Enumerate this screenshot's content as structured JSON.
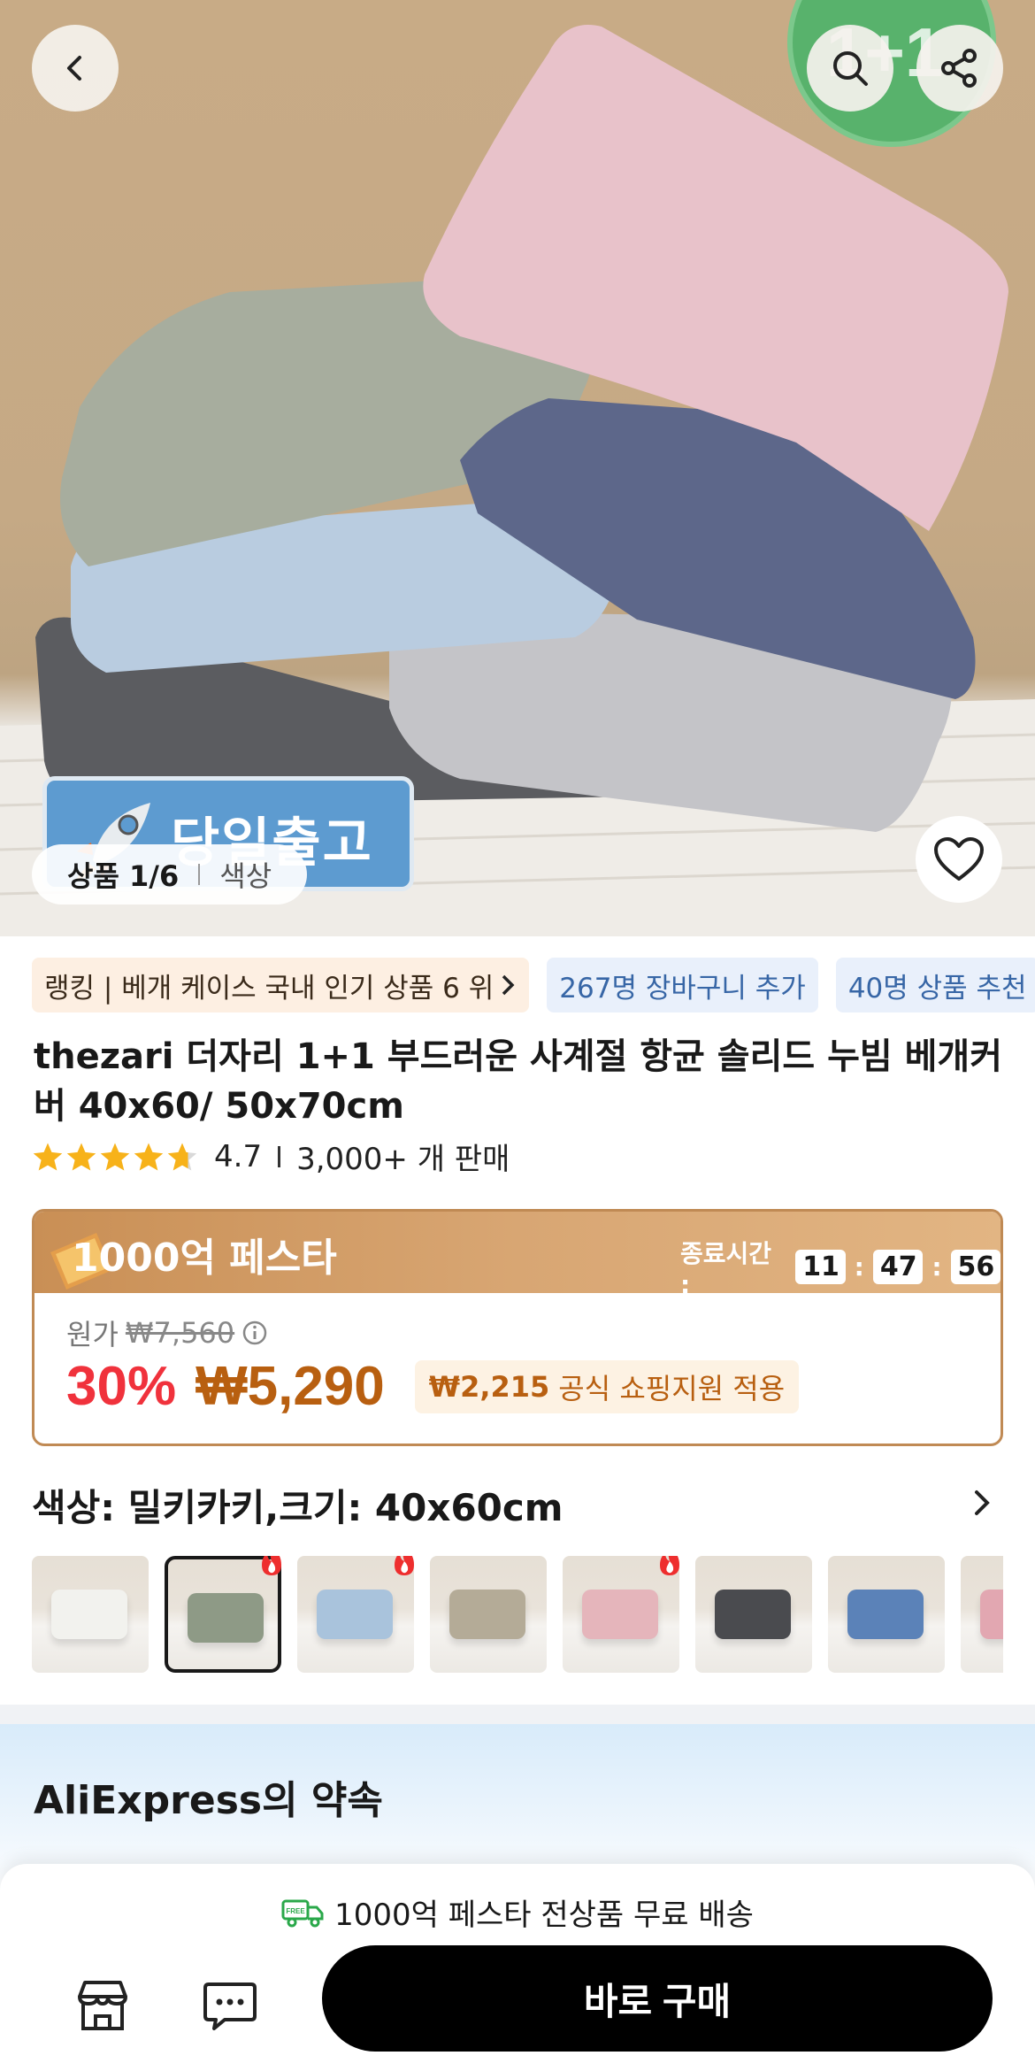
{
  "hero": {
    "promo_badge": "1+1",
    "shipping_badge": "당일출고",
    "pager": {
      "count": "상품 1/6",
      "tab": "색상"
    }
  },
  "tags": {
    "ranking": "랭킹 | 베개 케이스 국내 인기 상품 6 위",
    "cart": "267명 장바구니 추가",
    "recommend": "40명 상품 추천"
  },
  "product": {
    "brand": "thezari",
    "title_rest": "더자리 1+1 부드러운 사계절 항균 솔리드 누빔 베개커버 40x60/ 50x70cm",
    "rating": 4.7,
    "rating_text": "4.7",
    "sold": "3,000+ 개 판매"
  },
  "price_card": {
    "event_name": "1000억 페스타",
    "end_label": "종료시간 :",
    "timer": {
      "h": "11",
      "m": "47",
      "s": "56"
    },
    "original_label": "원가",
    "original_price": "₩7,560",
    "discount": "30%",
    "price": "₩5,290",
    "support_amount": "₩2,215",
    "support_text": "공식 쇼핑지원 적용"
  },
  "options": {
    "label": "색상: 밀키카키,크기: 40x60cm",
    "thumbs": [
      {
        "color": "#f2f2ee",
        "hot": false,
        "selected": false
      },
      {
        "color": "#8e9a86",
        "hot": true,
        "selected": true
      },
      {
        "color": "#a9c3dc",
        "hot": true,
        "selected": false
      },
      {
        "color": "#b4ab97",
        "hot": false,
        "selected": false
      },
      {
        "color": "#e5b5bb",
        "hot": true,
        "selected": false
      },
      {
        "color": "#4a4b4f",
        "hot": false,
        "selected": false
      },
      {
        "color": "#5b82b8",
        "hot": false,
        "selected": false
      },
      {
        "color": "#e2a7b1",
        "hot": false,
        "selected": false
      }
    ]
  },
  "promise": {
    "heading": "AliExpress의 약속"
  },
  "bottom": {
    "free_icon": "FREE",
    "shipping_text": "1000억 페스타 전상품 무료 배송",
    "buy_label": "바로 구매"
  },
  "colors": {
    "accent_red": "#f0323c",
    "price_brown": "#b85f10",
    "star": "#f7b21a",
    "tag_blue": "#3766a6"
  }
}
